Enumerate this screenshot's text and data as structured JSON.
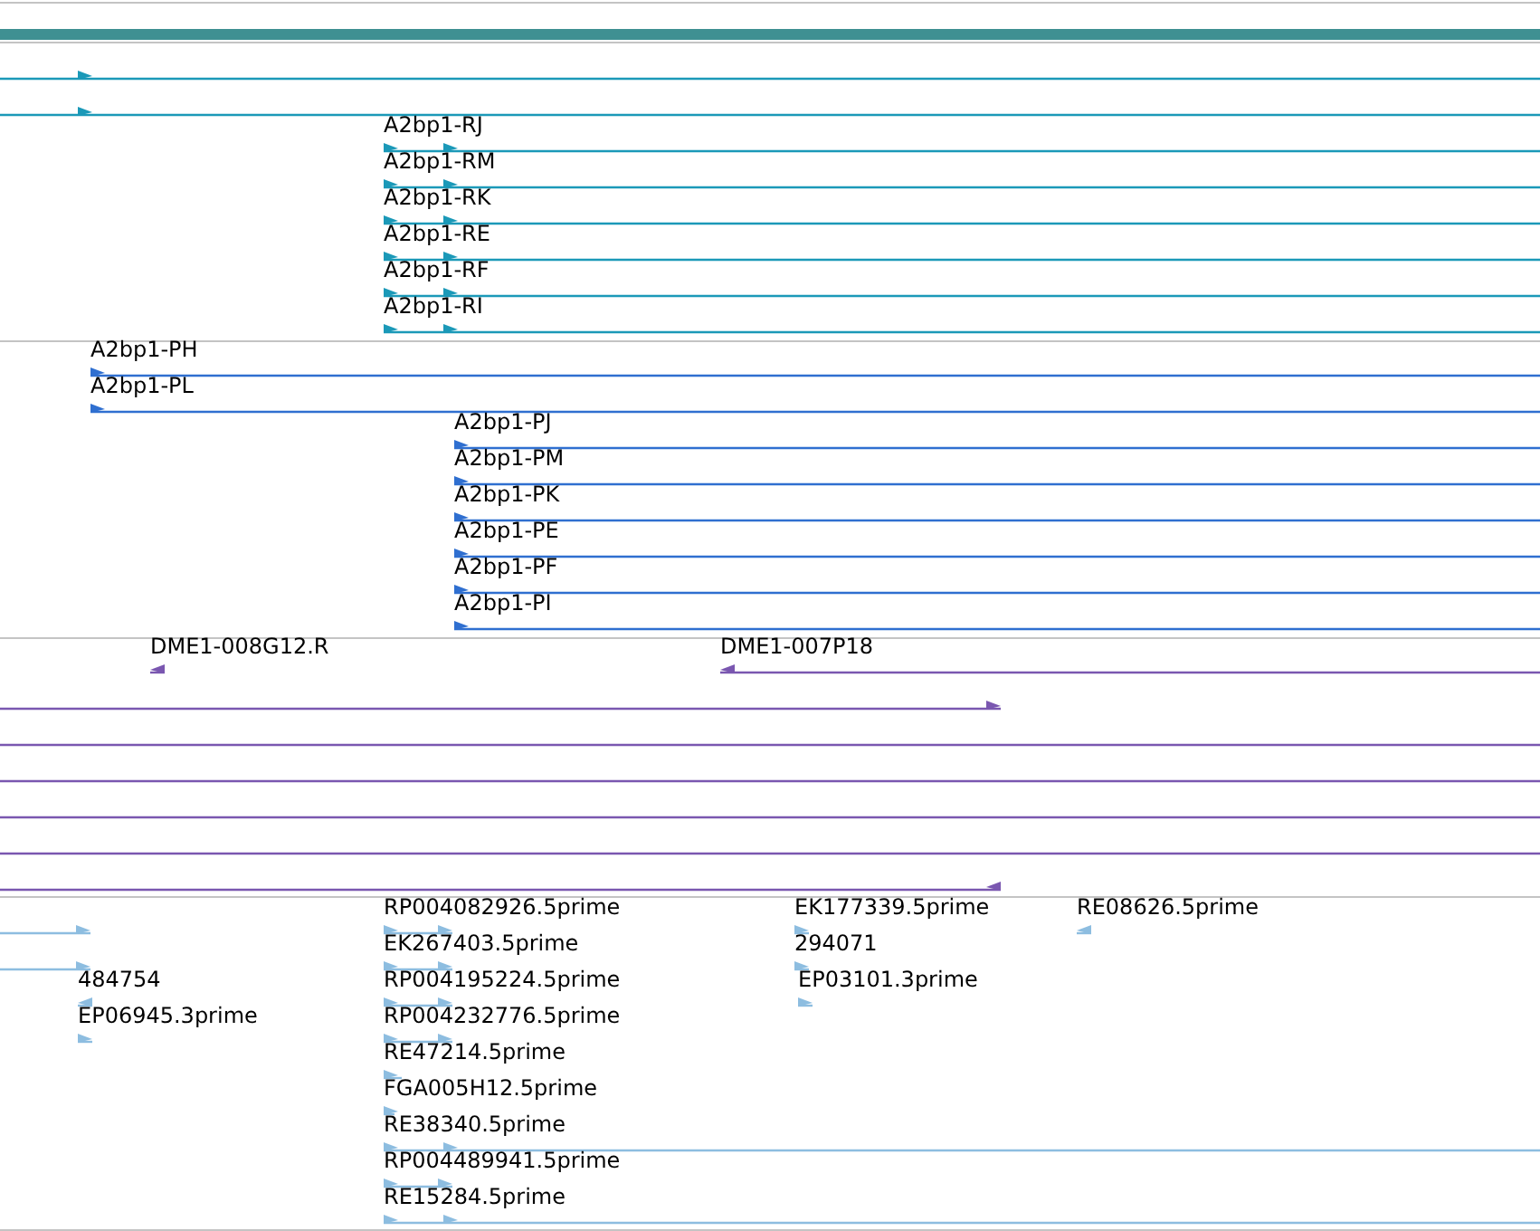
{
  "tracks": [
    {
      "color": "#1b99b8",
      "features": [
        {
          "reverse": false
        },
        {
          "reverse": false
        },
        {
          "label": "A2bp1-RJ",
          "reverse": false
        },
        {
          "label": "A2bp1-RM",
          "reverse": false
        },
        {
          "label": "A2bp1-RK",
          "reverse": false
        },
        {
          "label": "A2bp1-RE",
          "reverse": false
        },
        {
          "label": "A2bp1-RF",
          "reverse": false
        },
        {
          "label": "A2bp1-RI",
          "reverse": false
        }
      ]
    },
    {
      "color": "#2f6fd0",
      "features": [
        {
          "label": "A2bp1-PH",
          "reverse": false
        },
        {
          "label": "A2bp1-PL",
          "reverse": false
        },
        {
          "label": "A2bp1-PJ",
          "reverse": false
        },
        {
          "label": "A2bp1-PM",
          "reverse": false
        },
        {
          "label": "A2bp1-PK",
          "reverse": false
        },
        {
          "label": "A2bp1-PE",
          "reverse": false
        },
        {
          "label": "A2bp1-PF",
          "reverse": false
        },
        {
          "label": "A2bp1-PI",
          "reverse": false
        }
      ]
    },
    {
      "color": "#7a57b0",
      "features": [
        {
          "label": "DME1-008G12.R",
          "reverse": true,
          "arrowed": true
        },
        {
          "label": "DME1-007P18",
          "reverse": true,
          "arrowed": true
        },
        {
          "reverse": false,
          "arrowed": true
        },
        {
          "arrowed": false
        },
        {
          "arrowed": false
        },
        {
          "arrowed": false
        },
        {
          "arrowed": false
        },
        {
          "reverse": true,
          "arrowed": true
        }
      ]
    },
    {
      "color": "#8dbde0",
      "features": [
        {
          "reverse": false
        },
        {
          "reverse": false
        },
        {
          "label": "484754",
          "reverse": true
        },
        {
          "label": "EP06945.3prime",
          "reverse": false
        },
        {
          "label": "RP004082926.5prime",
          "reverse": false
        },
        {
          "label": "EK267403.5prime",
          "reverse": false
        },
        {
          "label": "RP004195224.5prime",
          "reverse": false
        },
        {
          "label": "RP004232776.5prime",
          "reverse": false
        },
        {
          "label": "RE47214.5prime",
          "reverse": false
        },
        {
          "label": "FGA005H12.5prime",
          "reverse": false
        },
        {
          "label": "RE38340.5prime",
          "reverse": false
        },
        {
          "label": "RP004489941.5prime",
          "reverse": false
        },
        {
          "label": "RE15284.5prime",
          "reverse": false
        },
        {
          "label": "EK177339.5prime",
          "reverse": false
        },
        {
          "label": "294071",
          "reverse": false
        },
        {
          "label": "EP03101.3prime",
          "reverse": false
        },
        {
          "label": "RE08626.5prime",
          "reverse": true
        }
      ]
    }
  ]
}
